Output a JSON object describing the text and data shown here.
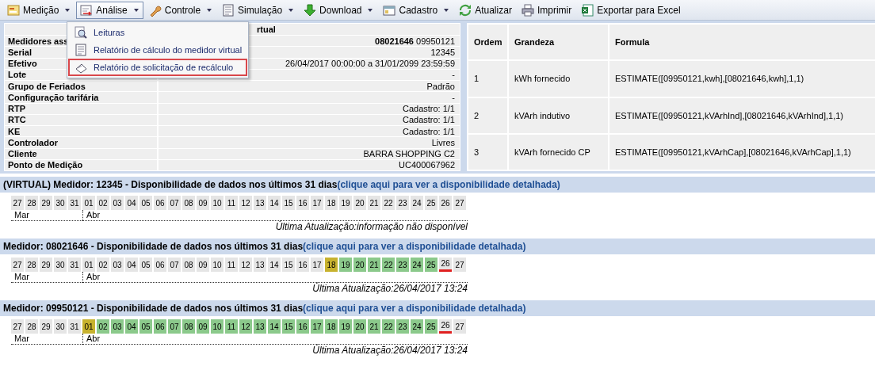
{
  "toolbar": [
    {
      "label": "Medição",
      "dropdown": true,
      "selected": false,
      "kind": "form"
    },
    {
      "label": "Análise",
      "dropdown": true,
      "selected": true,
      "kind": "chart"
    },
    {
      "label": "Controle",
      "dropdown": true,
      "selected": false,
      "kind": "wrench"
    },
    {
      "label": "Simulação",
      "dropdown": true,
      "selected": false,
      "kind": "doc"
    },
    {
      "label": "Download",
      "dropdown": true,
      "selected": false,
      "kind": "down"
    },
    {
      "label": "Cadastro",
      "dropdown": true,
      "selected": false,
      "kind": "card"
    },
    {
      "label": "Atualizar",
      "dropdown": false,
      "selected": false,
      "kind": "refresh"
    },
    {
      "label": "Imprimir",
      "dropdown": false,
      "selected": false,
      "kind": "printer"
    },
    {
      "label": "Exportar para Excel",
      "dropdown": false,
      "selected": false,
      "kind": "excel"
    }
  ],
  "menu": [
    {
      "label": "Leituras",
      "kind": "magnifier",
      "highlighted": false
    },
    {
      "label": "Relatório de cálculo do medidor virtual",
      "kind": "doc",
      "highlighted": false
    },
    {
      "label": "Relatório de solicitação de recálculo",
      "kind": "pencil",
      "highlighted": true
    }
  ],
  "details": {
    "title": "rtual",
    "rows": [
      {
        "label": "Medidores ass",
        "value": "**08021646** 09950121"
      },
      {
        "label": "Serial",
        "value": "12345"
      },
      {
        "label": "Efetivo",
        "value": "26/04/2017 00:00:00 a 31/01/2099 23:59:59"
      },
      {
        "label": "Lote",
        "value": "-"
      },
      {
        "label": "Grupo de Feriados",
        "value": "Padrão"
      },
      {
        "label": "Configuração tarifária",
        "value": "-"
      },
      {
        "label": "RTP",
        "value": "Cadastro: 1/1"
      },
      {
        "label": "RTC",
        "value": "Cadastro: 1/1"
      },
      {
        "label": "KE",
        "value": "Cadastro: 1/1"
      },
      {
        "label": "Controlador",
        "value": "Livres"
      },
      {
        "label": "Cliente",
        "value": "BARRA SHOPPING C2"
      },
      {
        "label": "Ponto de Medição",
        "value": "UC400067962"
      }
    ]
  },
  "formulas": {
    "columns": [
      "Ordem",
      "Grandeza",
      "Formula"
    ],
    "rows": [
      [
        "1",
        "kWh fornecido",
        "ESTIMATE([09950121,kwh],[08021646,kwh],1,1)"
      ],
      [
        "2",
        "kVArh indutivo",
        "ESTIMATE([09950121,kVArhInd],[08021646,kVArhInd],1,1)"
      ],
      [
        "3",
        "kVArh fornecido CP",
        "ESTIMATE([09950121,kVArhCap],[08021646,kVArhCap],1,1)"
      ]
    ]
  },
  "meters": [
    {
      "title": "(VIRTUAL) Medidor: 12345 - Disponibilidade de dados nos últimos 31 dias",
      "link": "(clique aqui para ver a disponibilidade detalhada)",
      "updated": "Última Atualização:informação não disponível",
      "months": [
        {
          "label": "Mar",
          "days": [
            {
              "label": "27",
              "kind": "none",
              "current": false
            },
            {
              "label": "28",
              "kind": "none",
              "current": false
            },
            {
              "label": "29",
              "kind": "none",
              "current": false
            },
            {
              "label": "30",
              "kind": "none",
              "current": false
            },
            {
              "label": "31",
              "kind": "none",
              "current": false
            }
          ]
        },
        {
          "label": "Abr",
          "days": [
            {
              "label": "01",
              "kind": "none",
              "current": false
            },
            {
              "label": "02",
              "kind": "none",
              "current": false
            },
            {
              "label": "03",
              "kind": "none",
              "current": false
            },
            {
              "label": "04",
              "kind": "none",
              "current": false
            },
            {
              "label": "05",
              "kind": "none",
              "current": false
            },
            {
              "label": "06",
              "kind": "none",
              "current": false
            },
            {
              "label": "07",
              "kind": "none",
              "current": false
            },
            {
              "label": "08",
              "kind": "none",
              "current": false
            },
            {
              "label": "09",
              "kind": "none",
              "current": false
            },
            {
              "label": "10",
              "kind": "none",
              "current": false
            },
            {
              "label": "11",
              "kind": "none",
              "current": false
            },
            {
              "label": "12",
              "kind": "none",
              "current": false
            },
            {
              "label": "13",
              "kind": "none",
              "current": false
            },
            {
              "label": "14",
              "kind": "none",
              "current": false
            },
            {
              "label": "15",
              "kind": "none",
              "current": false
            },
            {
              "label": "16",
              "kind": "none",
              "current": false
            },
            {
              "label": "17",
              "kind": "none",
              "current": false
            },
            {
              "label": "18",
              "kind": "none",
              "current": false
            },
            {
              "label": "19",
              "kind": "none",
              "current": false
            },
            {
              "label": "20",
              "kind": "none",
              "current": false
            },
            {
              "label": "21",
              "kind": "none",
              "current": false
            },
            {
              "label": "22",
              "kind": "none",
              "current": false
            },
            {
              "label": "23",
              "kind": "none",
              "current": false
            },
            {
              "label": "24",
              "kind": "none",
              "current": false
            },
            {
              "label": "25",
              "kind": "none",
              "current": false
            },
            {
              "label": "26",
              "kind": "none",
              "current": false
            },
            {
              "label": "27",
              "kind": "none",
              "current": false
            }
          ]
        }
      ]
    },
    {
      "title": "Medidor: 08021646 - Disponibilidade de dados nos últimos 31 dias",
      "link": "(clique aqui para ver a disponibilidade detalhada)",
      "updated": "Última Atualização:26/04/2017 13:24",
      "months": [
        {
          "label": "Mar",
          "days": [
            {
              "label": "27",
              "kind": "none",
              "current": false
            },
            {
              "label": "28",
              "kind": "none",
              "current": false
            },
            {
              "label": "29",
              "kind": "none",
              "current": false
            },
            {
              "label": "30",
              "kind": "none",
              "current": false
            },
            {
              "label": "31",
              "kind": "none",
              "current": false
            }
          ]
        },
        {
          "label": "Abr",
          "days": [
            {
              "label": "01",
              "kind": "none",
              "current": false
            },
            {
              "label": "02",
              "kind": "none",
              "current": false
            },
            {
              "label": "03",
              "kind": "none",
              "current": false
            },
            {
              "label": "04",
              "kind": "none",
              "current": false
            },
            {
              "label": "05",
              "kind": "none",
              "current": false
            },
            {
              "label": "06",
              "kind": "none",
              "current": false
            },
            {
              "label": "07",
              "kind": "none",
              "current": false
            },
            {
              "label": "08",
              "kind": "none",
              "current": false
            },
            {
              "label": "09",
              "kind": "none",
              "current": false
            },
            {
              "label": "10",
              "kind": "none",
              "current": false
            },
            {
              "label": "11",
              "kind": "none",
              "current": false
            },
            {
              "label": "12",
              "kind": "none",
              "current": false
            },
            {
              "label": "13",
              "kind": "none",
              "current": false
            },
            {
              "label": "14",
              "kind": "none",
              "current": false
            },
            {
              "label": "15",
              "kind": "none",
              "current": false
            },
            {
              "label": "16",
              "kind": "none",
              "current": false
            },
            {
              "label": "17",
              "kind": "none",
              "current": false
            },
            {
              "label": "18",
              "kind": "partial",
              "current": false
            },
            {
              "label": "19",
              "kind": "full",
              "current": false
            },
            {
              "label": "20",
              "kind": "full",
              "current": false
            },
            {
              "label": "21",
              "kind": "full",
              "current": false
            },
            {
              "label": "22",
              "kind": "full",
              "current": false
            },
            {
              "label": "23",
              "kind": "full",
              "current": false
            },
            {
              "label": "24",
              "kind": "full",
              "current": false
            },
            {
              "label": "25",
              "kind": "full",
              "current": false
            },
            {
              "label": "26",
              "kind": "none",
              "current": true
            },
            {
              "label": "27",
              "kind": "none",
              "current": false
            }
          ]
        }
      ]
    },
    {
      "title": "Medidor: 09950121 - Disponibilidade de dados nos últimos 31 dias",
      "link": "(clique aqui para ver a disponibilidade detalhada)",
      "updated": "Última Atualização:26/04/2017 13:24",
      "months": [
        {
          "label": "Mar",
          "days": [
            {
              "label": "27",
              "kind": "none",
              "current": false
            },
            {
              "label": "28",
              "kind": "none",
              "current": false
            },
            {
              "label": "29",
              "kind": "none",
              "current": false
            },
            {
              "label": "30",
              "kind": "none",
              "current": false
            },
            {
              "label": "31",
              "kind": "none",
              "current": false
            }
          ]
        },
        {
          "label": "Abr",
          "days": [
            {
              "label": "01",
              "kind": "partial",
              "current": false
            },
            {
              "label": "02",
              "kind": "full",
              "current": false
            },
            {
              "label": "03",
              "kind": "full",
              "current": false
            },
            {
              "label": "04",
              "kind": "full",
              "current": false
            },
            {
              "label": "05",
              "kind": "full",
              "current": false
            },
            {
              "label": "06",
              "kind": "full",
              "current": false
            },
            {
              "label": "07",
              "kind": "full",
              "current": false
            },
            {
              "label": "08",
              "kind": "full",
              "current": false
            },
            {
              "label": "09",
              "kind": "full",
              "current": false
            },
            {
              "label": "10",
              "kind": "full",
              "current": false
            },
            {
              "label": "11",
              "kind": "full",
              "current": false
            },
            {
              "label": "12",
              "kind": "full",
              "current": false
            },
            {
              "label": "13",
              "kind": "full",
              "current": false
            },
            {
              "label": "14",
              "kind": "full",
              "current": false
            },
            {
              "label": "15",
              "kind": "full",
              "current": false
            },
            {
              "label": "16",
              "kind": "full",
              "current": false
            },
            {
              "label": "17",
              "kind": "full",
              "current": false
            },
            {
              "label": "18",
              "kind": "full",
              "current": false
            },
            {
              "label": "19",
              "kind": "full",
              "current": false
            },
            {
              "label": "20",
              "kind": "full",
              "current": false
            },
            {
              "label": "21",
              "kind": "full",
              "current": false
            },
            {
              "label": "22",
              "kind": "full",
              "current": false
            },
            {
              "label": "23",
              "kind": "full",
              "current": false
            },
            {
              "label": "24",
              "kind": "full",
              "current": false
            },
            {
              "label": "25",
              "kind": "full",
              "current": false
            },
            {
              "label": "26",
              "kind": "none",
              "current": true
            },
            {
              "label": "27",
              "kind": "none",
              "current": false
            }
          ]
        }
      ]
    }
  ]
}
